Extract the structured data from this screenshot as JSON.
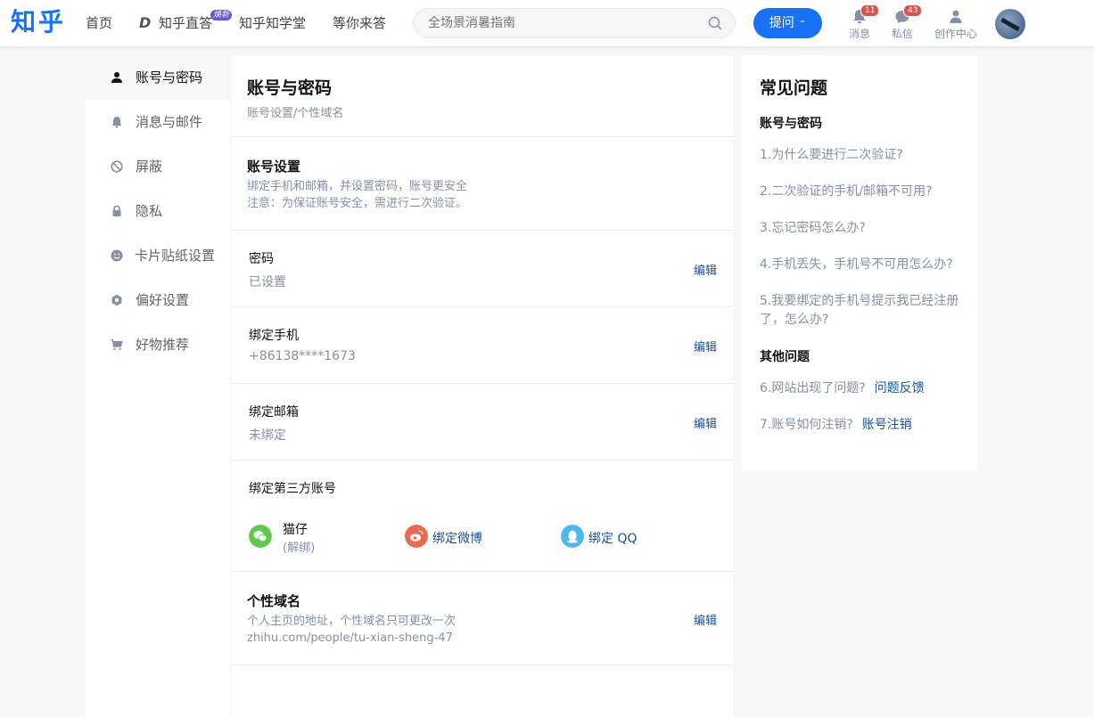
{
  "header": {
    "logo": "知乎",
    "nav": [
      "首页",
      "知乎直答",
      "知乎知学堂",
      "等你来答"
    ],
    "new_badge": "焕新",
    "search_placeholder": "全场景消暑指南",
    "ask_label": "提问",
    "notifications": {
      "label": "消息",
      "count": "11"
    },
    "messages": {
      "label": "私信",
      "count": "43"
    },
    "creator": {
      "label": "创作中心"
    }
  },
  "sidebar": {
    "items": [
      {
        "label": "账号与密码",
        "icon": "user-icon"
      },
      {
        "label": "消息与邮件",
        "icon": "bell-icon"
      },
      {
        "label": "屏蔽",
        "icon": "block-icon"
      },
      {
        "label": "隐私",
        "icon": "lock-icon"
      },
      {
        "label": "卡片贴纸设置",
        "icon": "smile-icon"
      },
      {
        "label": "偏好设置",
        "icon": "gear-icon"
      },
      {
        "label": "好物推荐",
        "icon": "cart-icon"
      }
    ]
  },
  "main": {
    "title": "账号与密码",
    "subtitle": "账号设置/个性域名",
    "account_settings": {
      "title": "账号设置",
      "desc1": "绑定手机和邮箱，并设置密码，账号更安全",
      "desc2": "注意：为保证账号安全，需进行二次验证。"
    },
    "rows": [
      {
        "label": "密码",
        "value": "已设置",
        "action": "编辑"
      },
      {
        "label": "绑定手机",
        "value": "+86138****1673",
        "action": "编辑"
      },
      {
        "label": "绑定邮箱",
        "value": "未绑定",
        "action": "编辑"
      }
    ],
    "third_party": {
      "title": "绑定第三方账号",
      "wechat_name": "猫仔",
      "wechat_unbind": "(解绑)",
      "weibo": "绑定微博",
      "qq": "绑定 QQ"
    },
    "domain": {
      "title": "个性域名",
      "desc": "个人主页的地址，个性域名只可更改一次",
      "url": "zhihu.com/people/tu-xian-sheng-47",
      "action": "编辑"
    }
  },
  "faq": {
    "title": "常见问题",
    "section1": "账号与密码",
    "q1": "1.为什么要进行二次验证?",
    "q2": "2.二次验证的手机/邮箱不可用?",
    "q3": "3.忘记密码怎么办?",
    "q4": "4.手机丢失，手机号不可用怎么办?",
    "q5": "5.我要绑定的手机号提示我已经注册了，怎么办?",
    "section2": "其他问题",
    "q6": "6.网站出现了问题?",
    "q6_link": "问题反馈",
    "q7": "7.账号如何注销?",
    "q7_link": "账号注销"
  },
  "colors": {
    "brand": "#1772f6",
    "link": "#175199",
    "muted": "#8590a6",
    "badge": "#d9534f"
  }
}
